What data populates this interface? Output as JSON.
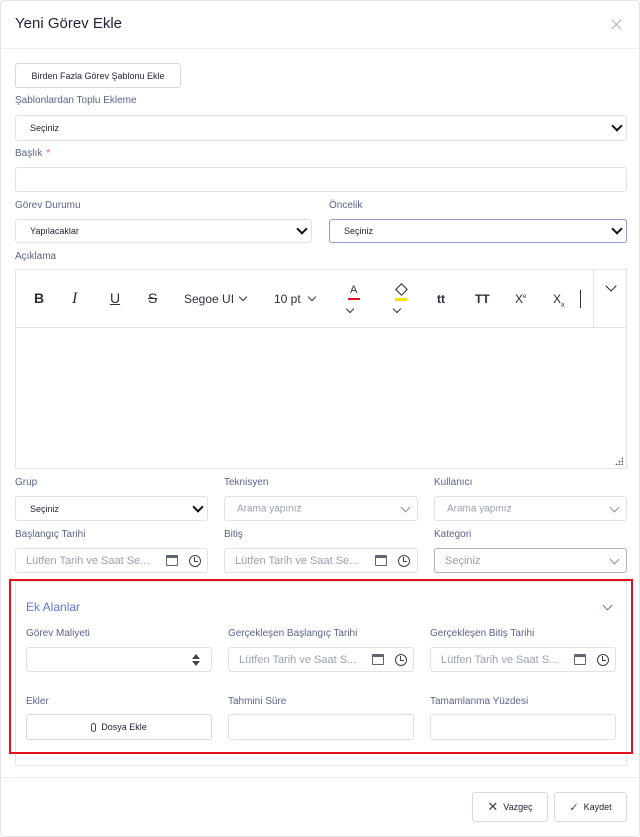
{
  "modal": {
    "title": "Yeni Görev Ekle"
  },
  "template_button": "Birden Fazla Görev Şablonu Ekle",
  "bulk_template": {
    "label": "Şablonlardan Toplu Ekleme",
    "value": "Seçiniz"
  },
  "title_field": {
    "label": "Başlık",
    "required_mark": "*",
    "value": ""
  },
  "status": {
    "label": "Görev Durumu",
    "value": "Yapılacaklar"
  },
  "priority": {
    "label": "Öncelik",
    "value": "Seçiniz"
  },
  "description": {
    "label": "Açıklama",
    "toolbar": {
      "bold": "B",
      "italic": "I",
      "underline": "U",
      "strike": "S",
      "font": "Segoe UI",
      "size": "10 pt",
      "font_color": "A",
      "case1": "tt",
      "case2": "TT",
      "sup": "X",
      "sub": "X"
    }
  },
  "group": {
    "label": "Grup",
    "value": "Seçiniz"
  },
  "technician": {
    "label": "Teknisyen",
    "placeholder": "Arama yapınız"
  },
  "user": {
    "label": "Kullanıcı",
    "placeholder": "Arama yapınız"
  },
  "start_date": {
    "label": "Başlangıç Tarihi",
    "placeholder": "Lütfen Tarih ve Saat Se..."
  },
  "end_date": {
    "label": "Bitiş",
    "placeholder": "Lütfen Tarih ve Saat Se..."
  },
  "category": {
    "label": "Kategori",
    "value": "Seçiniz"
  },
  "extra_fields": {
    "title": "Ek Alanlar",
    "cost": {
      "label": "Görev Maliyeti",
      "value": ""
    },
    "actual_start": {
      "label": "Gerçekleşen Başlangıç Tarihi",
      "placeholder": "Lütfen Tarih ve Saat S..."
    },
    "actual_end": {
      "label": "Gerçekleşen Bitiş Tarihi",
      "placeholder": "Lütfen Tarih ve Saat S..."
    },
    "attachments": {
      "label": "Ekler",
      "button": "Dosya Ekle"
    },
    "estimated_time": {
      "label": "Tahmini Süre",
      "value": ""
    },
    "completion": {
      "label": "Tamamlanma Yüzdesi",
      "value": ""
    }
  },
  "footer": {
    "cancel": "Vazgeç",
    "save": "Kaydet"
  },
  "colors": {
    "highlight": "#e4101a",
    "accent": "#5b78d6",
    "font_color_bar": "#e4101a",
    "fill_color_bar": "#f2e600"
  }
}
